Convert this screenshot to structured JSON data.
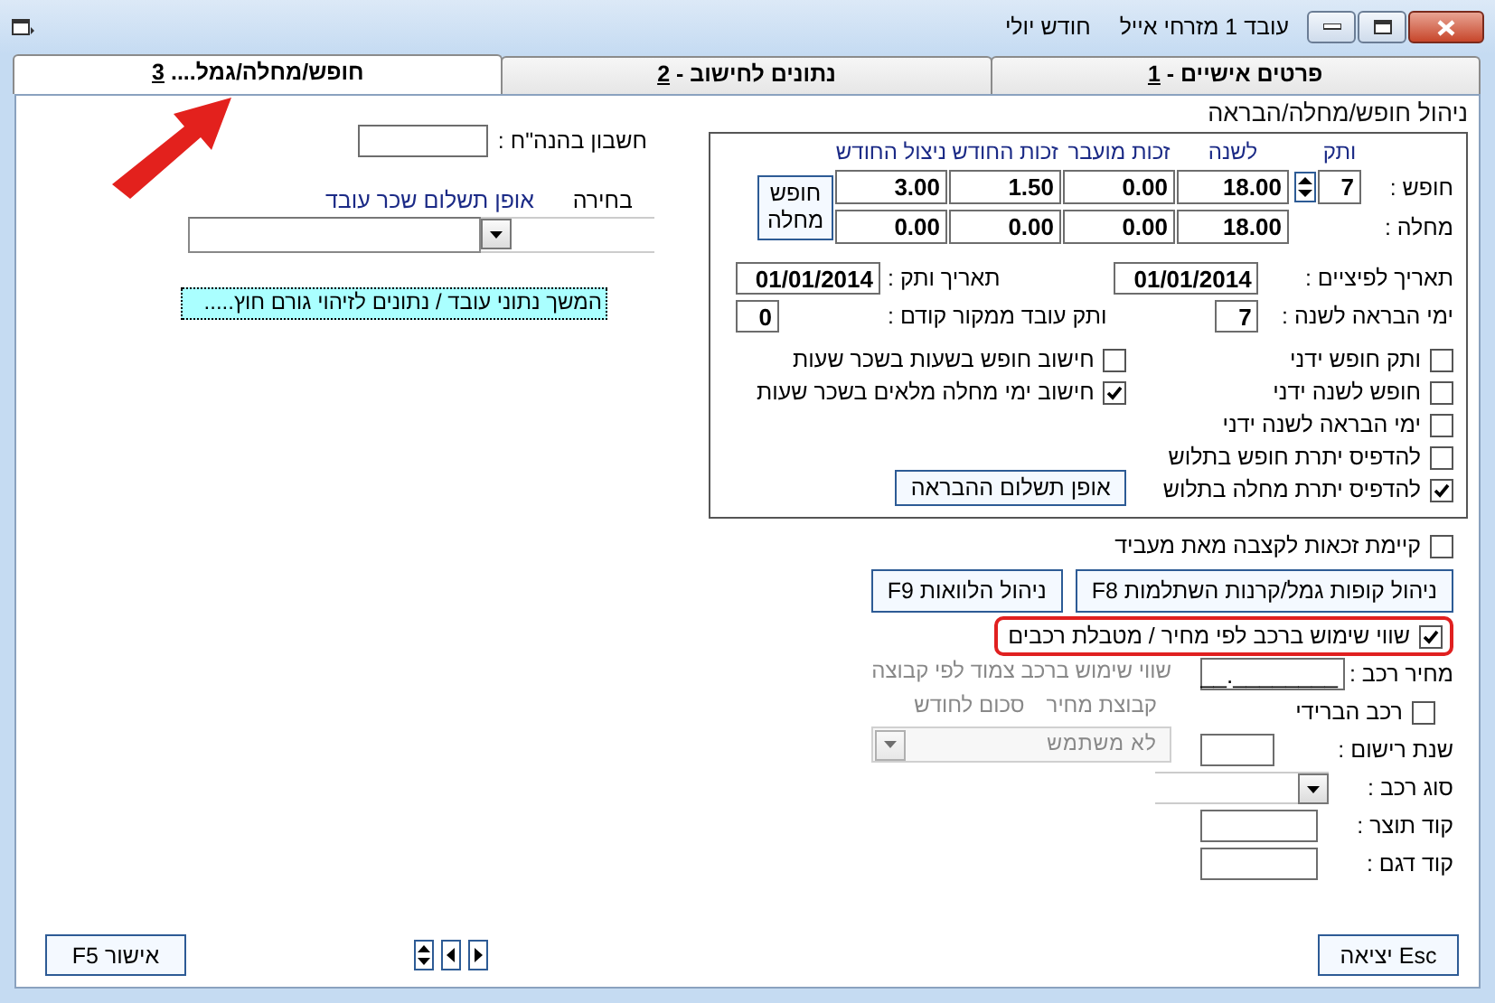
{
  "window": {
    "employee": "עובד 1 מזרחי אייל",
    "month": "חודש יולי"
  },
  "tabs": [
    {
      "label": "פרטים אישיים -",
      "hotkey": "1",
      "selected": false
    },
    {
      "label": "נתונים לחישוב -",
      "hotkey": "2",
      "selected": false
    },
    {
      "label": "חופש/מחלה/גמל....",
      "hotkey": "3",
      "selected": true
    }
  ],
  "vacation": {
    "title": "ניהול חופש/מחלה/הבראה",
    "columns": [
      "ותק",
      "לשנה",
      "זכות מועבר",
      "זכות החודש",
      "ניצול החודש"
    ],
    "rows": [
      {
        "label": "חופש :",
        "seniority": "7",
        "values": [
          "18.00",
          "0.00",
          "1.50",
          "3.00"
        ]
      },
      {
        "label": "מחלה :",
        "values": [
          "18.00",
          "0.00",
          "0.00",
          "0.00"
        ]
      }
    ],
    "side_button": "חופש מחלה",
    "fields": [
      {
        "label": "תאריך לפיציים :",
        "value": "01/01/2014"
      },
      {
        "label": "תאריך ותק :",
        "value": "01/01/2014"
      },
      {
        "label": "ימי הבראה לשנה :",
        "value": "7"
      },
      {
        "label": "ותק עובד ממקור קודם :",
        "value": "0"
      }
    ],
    "checkboxes_right": [
      {
        "label": "ותק חופש ידני",
        "checked": false
      },
      {
        "label": "חופש לשנה ידני",
        "checked": false
      },
      {
        "label": "ימי הבראה לשנה ידני",
        "checked": false
      },
      {
        "label": "להדפיס יתרת חופש בתלוש",
        "checked": false
      },
      {
        "label": "להדפיס יתרת מחלה בתלוש",
        "checked": true
      }
    ],
    "checkboxes_left": [
      {
        "label": "חישוב חופש בשעות בשכר שעות",
        "checked": false
      },
      {
        "label": "חישוב ימי מחלה מלאים בשכר שעות",
        "checked": true
      }
    ],
    "recovery_button": "אופן תשלום ההבראה"
  },
  "pension": {
    "label": "קיימת זכאות לקצבה מאת מעביד",
    "checked": false
  },
  "action_buttons": [
    "ניהול קופות גמל/קרנות השתלמות F8",
    "ניהול הלוואות F9"
  ],
  "car": {
    "usage": {
      "label": "שווי שימוש ברכב לפי מחיר / מטבלת רכבים",
      "checked": true,
      "highlighted": true
    },
    "price": {
      "label": "מחיר רכב :",
      "value": "________.__"
    },
    "hybrid": {
      "label": "רכב הברידי",
      "checked": false
    },
    "fields": [
      {
        "label": "שנת רישום :",
        "kind": "text"
      },
      {
        "label": "סוג רכב :",
        "kind": "combo"
      },
      {
        "label": "קוד תוצר :",
        "kind": "text"
      },
      {
        "label": "קוד דגם :",
        "kind": "text"
      }
    ],
    "group": {
      "title": "שווי שימוש ברכב צמוד לפי קבוצה",
      "columns": [
        "קבוצת מחיר",
        "סכום לחודש"
      ],
      "value": "לא משתמש",
      "disabled": true
    }
  },
  "side": {
    "account_label": "חשבון בהנה\"ח :",
    "choice_label": "בחירה",
    "method_label": "אופן תשלום שכר עובד",
    "link": "המשך נתוני עובד / נתונים לזיהוי גורם חוץ....."
  },
  "footer": {
    "exit": "Esc יציאה",
    "ok": "אישור F5"
  }
}
